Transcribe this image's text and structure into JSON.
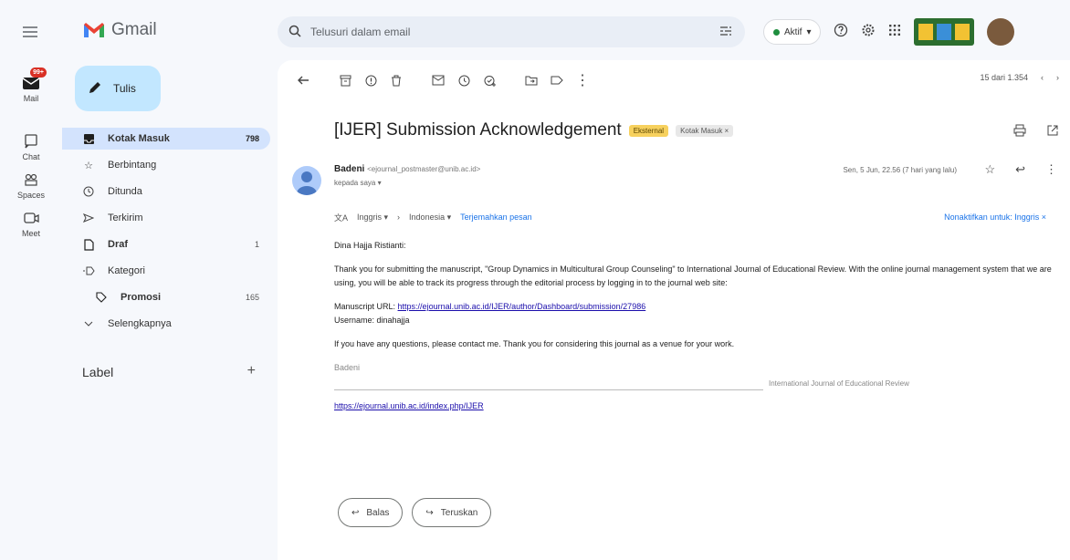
{
  "rail": {
    "mail_label": "Mail",
    "mail_badge": "99+",
    "chat_label": "Chat",
    "spaces_label": "Spaces",
    "meet_label": "Meet"
  },
  "brand": {
    "name": "Gmail"
  },
  "compose": {
    "label": "Tulis"
  },
  "nav": {
    "items": [
      {
        "label": "Kotak Masuk",
        "count": "798",
        "icon": "inbox-icon"
      },
      {
        "label": "Berbintang",
        "count": "",
        "icon": "star-icon"
      },
      {
        "label": "Ditunda",
        "count": "",
        "icon": "clock-icon"
      },
      {
        "label": "Terkirim",
        "count": "",
        "icon": "send-icon"
      },
      {
        "label": "Draf",
        "count": "1",
        "icon": "draft-icon"
      },
      {
        "label": "Kategori",
        "count": "",
        "icon": "label-icon"
      },
      {
        "label": "Promosi",
        "count": "165",
        "icon": "tag-icon"
      },
      {
        "label": "Selengkapnya",
        "count": "",
        "icon": "chevron-down-icon"
      }
    ],
    "label_heading": "Label"
  },
  "search": {
    "placeholder": "Telusuri dalam email"
  },
  "status": {
    "label": "Aktif"
  },
  "pager": {
    "text": "15 dari 1.354"
  },
  "email": {
    "subject": "[IJER] Submission Acknowledgement",
    "chip_external": "Eksternal",
    "chip_inbox": "Kotak Masuk ×",
    "sender_name": "Badeni",
    "sender_email": "<ejournal_postmaster@unib.ac.id>",
    "to": "kepada saya ▾",
    "date": "Sen, 5 Jun, 22.56 (7 hari yang lalu)",
    "translate_from": "Inggris ▾",
    "translate_arrow": "›",
    "translate_to": "Indonesia ▾",
    "translate_link": "Terjemahkan pesan",
    "translate_off": "Nonaktifkan untuk: Inggris ×",
    "greeting": "Dina Hajja Ristianti:",
    "paragraph1": "Thank you for submitting the manuscript, \"Group Dynamics in Multicultural Group Counseling\" to International Journal of Educational Review. With the online journal management system that we are using, you will be able to track its progress through the editorial process by logging in to the journal web site:",
    "manuscript_label": "Manuscript URL:",
    "manuscript_url": "https://ejournal.unib.ac.id/IJER/author/Dashboard/submission/27986",
    "username_line": "Username: dinahajja",
    "paragraph2": "If you have any questions, please contact me. Thank you for considering this journal as a venue for your work.",
    "signature_name": "Badeni",
    "signature_journal": "International Journal of Educational Review",
    "signature_url": "https://ejournal.unib.ac.id/index.php/IJER"
  },
  "actions": {
    "reply": "Balas",
    "forward": "Teruskan"
  },
  "colors": {
    "accent": "#c2e7ff",
    "active_nav": "#d3e3fd",
    "external_chip": "#f7d15e"
  }
}
